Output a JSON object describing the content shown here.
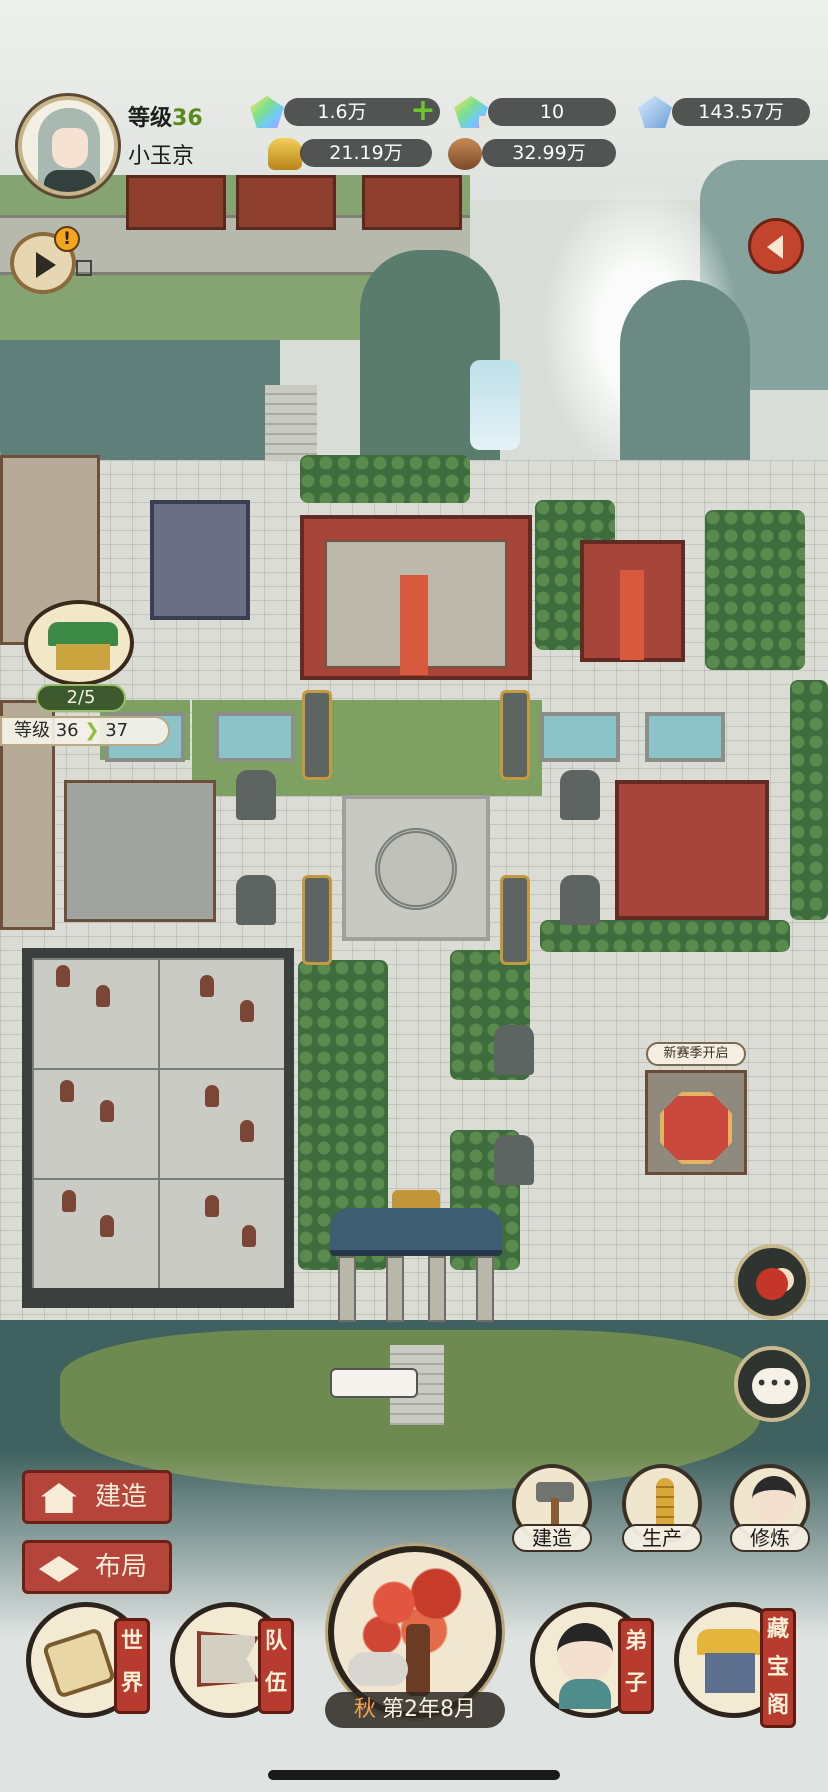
{
  "player": {
    "level_label": "等级",
    "level": "36",
    "name": "小玉京"
  },
  "resources": {
    "jade": "1.6万",
    "bound_jade": "10",
    "spirit_stone": "143.57万",
    "gold": "21.19万",
    "wood": "32.99万"
  },
  "alerts": {
    "replay_badge": "!"
  },
  "sect": {
    "progress": "2/5",
    "level_label": "等级",
    "level_current": "36",
    "level_next": "37"
  },
  "map": {
    "shrine_tag": "新赛季开启"
  },
  "side_actions": {
    "build": "建造",
    "produce": "生产",
    "cultivate": "修炼"
  },
  "left_buttons": {
    "build": "建造",
    "layout": "布局"
  },
  "bottom_nav": {
    "world": "世界",
    "team": "队伍",
    "disciples": "弟子",
    "treasure": "藏宝阁"
  },
  "calendar": {
    "season": "秋",
    "date": "第2年8月"
  },
  "colors": {
    "level_green": "#5a8a1a",
    "primary_red": "#b5453a",
    "hud_dark": "#373a38"
  }
}
